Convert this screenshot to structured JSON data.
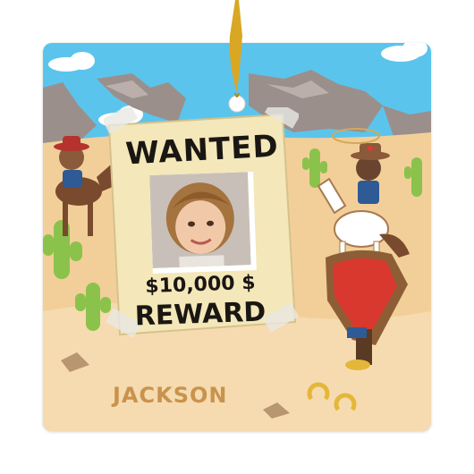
{
  "poster": {
    "title": "WANTED",
    "amount": "$10,000 $",
    "reward": "REWARD"
  },
  "personalized_name": "JACKSON",
  "colors": {
    "sky": "#5bc4ec",
    "desert": "#f2cf99",
    "rocks": "#9b8f8c",
    "cactus": "#8bc24c",
    "paper": "#f4e7b9",
    "name": "#c9934d",
    "ribbon": "#d8a723"
  },
  "icons": [
    "ornament-hook",
    "cactus-icon",
    "cowboy-icon",
    "horse-icon",
    "saddle-icon",
    "horseshoe-icon",
    "lasso-icon"
  ]
}
